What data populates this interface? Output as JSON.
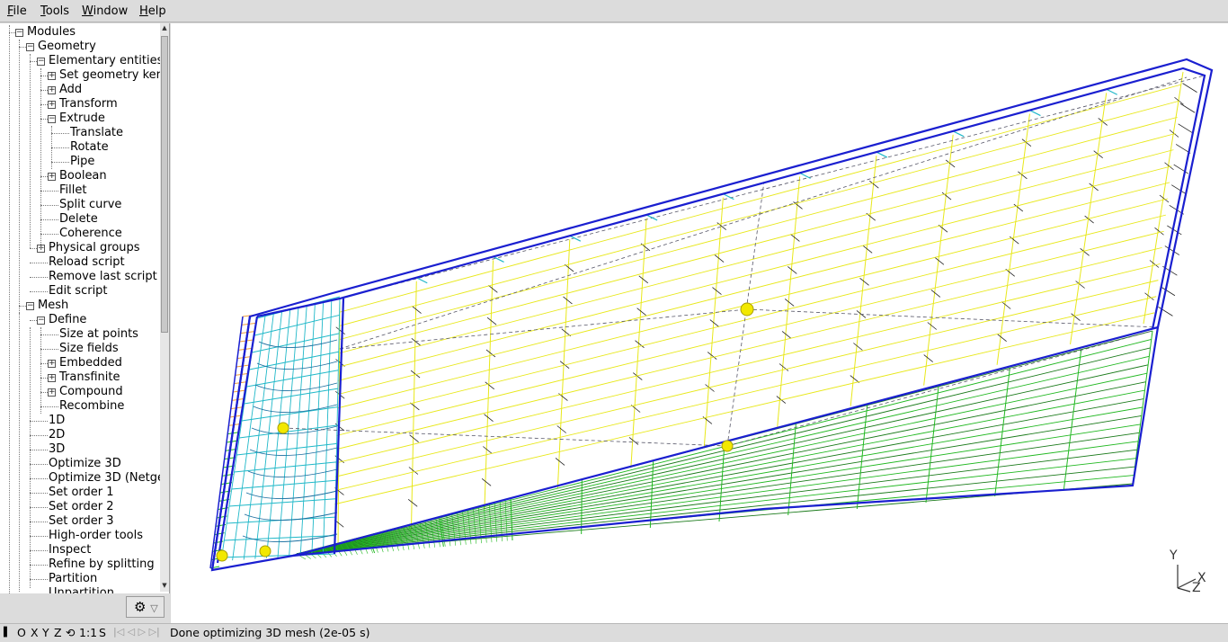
{
  "menu": {
    "items": [
      "File",
      "Tools",
      "Window",
      "Help"
    ],
    "underline": [
      "F",
      "T",
      "W",
      "H"
    ]
  },
  "tree": [
    {
      "label": "Modules",
      "level": 0,
      "toggle": "minus"
    },
    {
      "label": "Geometry",
      "level": 1,
      "toggle": "minus"
    },
    {
      "label": "Elementary entities",
      "level": 2,
      "toggle": "minus"
    },
    {
      "label": "Set geometry ker",
      "level": 3,
      "toggle": "plus"
    },
    {
      "label": "Add",
      "level": 3,
      "toggle": "plus"
    },
    {
      "label": "Transform",
      "level": 3,
      "toggle": "plus"
    },
    {
      "label": "Extrude",
      "level": 3,
      "toggle": "minus"
    },
    {
      "label": "Translate",
      "level": 4,
      "toggle": ""
    },
    {
      "label": "Rotate",
      "level": 4,
      "toggle": ""
    },
    {
      "label": "Pipe",
      "level": 4,
      "toggle": ""
    },
    {
      "label": "Boolean",
      "level": 3,
      "toggle": "plus"
    },
    {
      "label": "Fillet",
      "level": 3,
      "toggle": ""
    },
    {
      "label": "Split curve",
      "level": 3,
      "toggle": ""
    },
    {
      "label": "Delete",
      "level": 3,
      "toggle": ""
    },
    {
      "label": "Coherence",
      "level": 3,
      "toggle": ""
    },
    {
      "label": "Physical groups",
      "level": 2,
      "toggle": "plus"
    },
    {
      "label": "Reload script",
      "level": 2,
      "toggle": ""
    },
    {
      "label": "Remove last script c",
      "level": 2,
      "toggle": ""
    },
    {
      "label": "Edit script",
      "level": 2,
      "toggle": ""
    },
    {
      "label": "Mesh",
      "level": 1,
      "toggle": "minus"
    },
    {
      "label": "Define",
      "level": 2,
      "toggle": "minus"
    },
    {
      "label": "Size at points",
      "level": 3,
      "toggle": ""
    },
    {
      "label": "Size fields",
      "level": 3,
      "toggle": ""
    },
    {
      "label": "Embedded",
      "level": 3,
      "toggle": "plus"
    },
    {
      "label": "Transfinite",
      "level": 3,
      "toggle": "plus"
    },
    {
      "label": "Compound",
      "level": 3,
      "toggle": "plus"
    },
    {
      "label": "Recombine",
      "level": 3,
      "toggle": ""
    },
    {
      "label": "1D",
      "level": 2,
      "toggle": ""
    },
    {
      "label": "2D",
      "level": 2,
      "toggle": ""
    },
    {
      "label": "3D",
      "level": 2,
      "toggle": ""
    },
    {
      "label": "Optimize 3D",
      "level": 2,
      "toggle": ""
    },
    {
      "label": "Optimize 3D (Netge",
      "level": 2,
      "toggle": ""
    },
    {
      "label": "Set order 1",
      "level": 2,
      "toggle": ""
    },
    {
      "label": "Set order 2",
      "level": 2,
      "toggle": ""
    },
    {
      "label": "Set order 3",
      "level": 2,
      "toggle": ""
    },
    {
      "label": "High-order tools",
      "level": 2,
      "toggle": ""
    },
    {
      "label": "Inspect",
      "level": 2,
      "toggle": ""
    },
    {
      "label": "Refine by splitting",
      "level": 2,
      "toggle": ""
    },
    {
      "label": "Partition",
      "level": 2,
      "toggle": ""
    },
    {
      "label": "Unpartition",
      "level": 2,
      "toggle": ""
    }
  ],
  "gear": {
    "icon": "gear-icon",
    "glyph": "⚙",
    "arrow": "▽"
  },
  "status": {
    "o": "O",
    "x": "X",
    "y": "Y",
    "z": "Z",
    "rotate_glyph": "⟲",
    "scale": "1:1",
    "s": "S",
    "nav_glyphs": "|◁ ◁ ▷ ▷|",
    "message": "Done optimizing 3D mesh (2e-05 s)"
  },
  "axes": {
    "y": "Y",
    "x": "X",
    "z": "Z"
  },
  "colors": {
    "mesh_blue": "#1a1fd0",
    "mesh_yellow": "#e8e81a",
    "mesh_green": "#22b822",
    "mesh_cyan": "#20b8c8",
    "mesh_orange": "#f0a040",
    "point_yellow": "#f2e800"
  }
}
